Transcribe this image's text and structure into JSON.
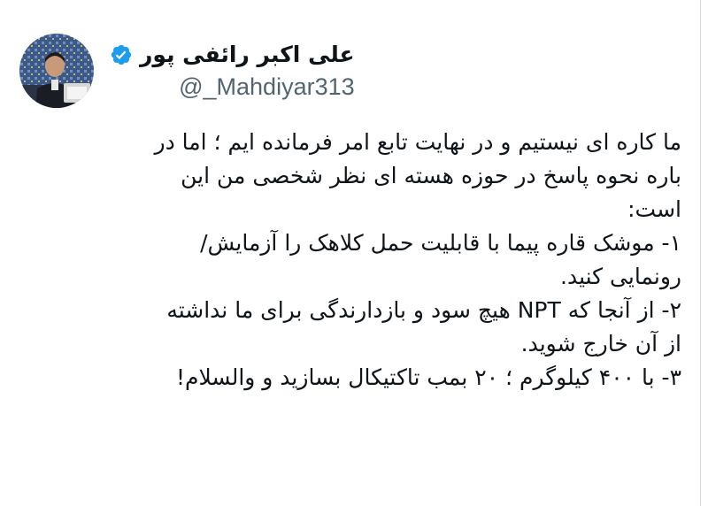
{
  "tweet": {
    "author": {
      "display_name": "علی اکبر رائفی پور",
      "handle": "@_Mahdiyar313",
      "verified": true,
      "verified_color": "#1d9bf0"
    },
    "text_lines": [
      "ما کاره ای نیستیم و در نهایت تابع امر فرمانده ایم ؛ اما در",
      "باره نحوه پاسخ در حوزه هسته ای نظر شخصی من این",
      "است:",
      "۱- موشک قاره پیما با قابلیت حمل کلاهک را آزمایش/",
      "رونمایی کنید.",
      "۲- از آنجا که NPT هیچ سود و بازدارندگی برای ما نداشته",
      "از آن خارج شوید.",
      "۳- با ۴۰۰ کیلوگرم ؛ ۲۰ بمب تاکتیکال بسازید و والسلام!"
    ]
  },
  "colors": {
    "text": "#0f1419",
    "muted": "#536471",
    "background": "#ffffff"
  },
  "icons": {
    "verified": "verified-badge-icon",
    "avatar": "avatar-photo"
  }
}
